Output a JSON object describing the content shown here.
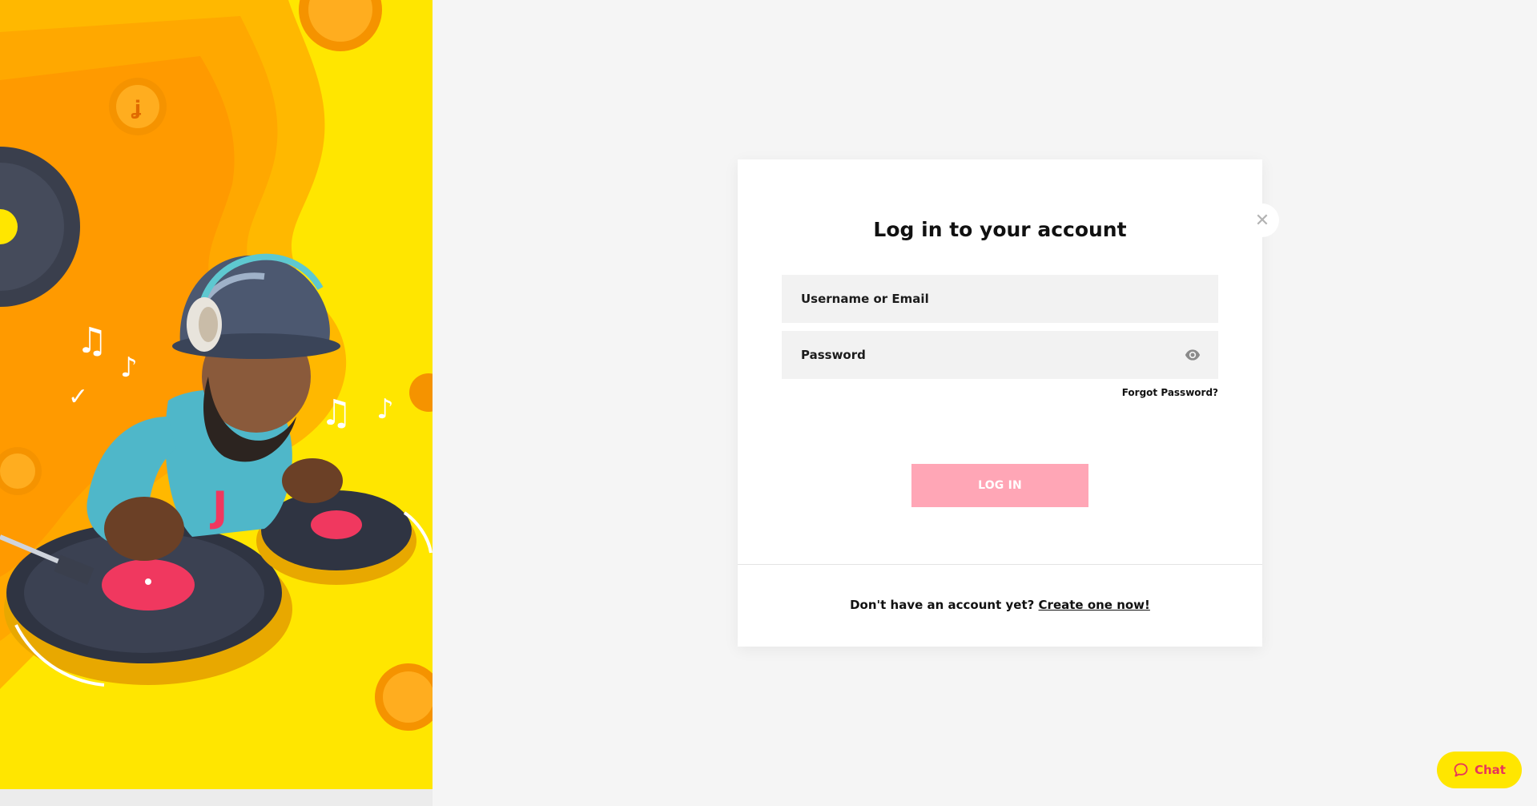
{
  "login": {
    "title": "Log in to your account",
    "username_placeholder": "Username or Email",
    "password_placeholder": "Password",
    "forgot_password": "Forgot Password?",
    "login_button": "LOG IN",
    "no_account_text": "Don't have an account yet?",
    "create_account_link": "Create one now!",
    "close_icon": "close-icon",
    "show_password_icon": "eye-icon"
  },
  "chat": {
    "label": "Chat",
    "icon": "chat-bubble-icon"
  },
  "hero": {
    "image": "dj-gnome-mascot-illustration"
  },
  "colors": {
    "hero_yellow": "#ffe600",
    "accent_pink": "#e8355a",
    "button_disabled_pink": "#ffa6b6",
    "page_background": "#f5f5f5",
    "field_background": "#f2f2f2"
  }
}
